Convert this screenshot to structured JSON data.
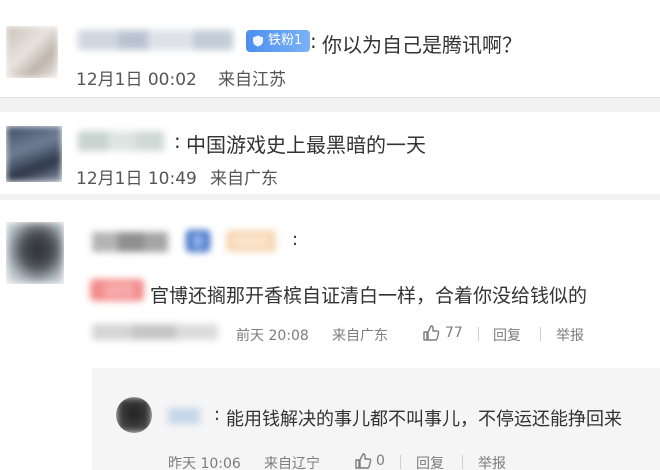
{
  "comments": [
    {
      "badge": "铁粉1",
      "text": "你以为自己是腾讯啊？",
      "colon": ":",
      "date": "12月1日 00:02",
      "location": "来自江苏"
    },
    {
      "colon": ":",
      "text": "中国游戏史上最黑暗的一天",
      "date": "12月1日 10:49",
      "location": "来自广东"
    },
    {
      "colon": ":",
      "text": "官博还搁那开香槟自证清白一样，合着你没给钱似的",
      "time": "前天 20:08",
      "location": "来自广东",
      "likes": "77",
      "reply_label": "回复",
      "report_label": "举报"
    }
  ],
  "reply": {
    "colon": ":",
    "text": "能用钱解决的事儿都不叫事儿，不停运还能挣回来",
    "time": "昨天 10:06",
    "location": "来自辽宁",
    "likes": "0",
    "reply_label": "回复",
    "report_label": "举报"
  },
  "colors": {
    "page_bg": "#f2f2f2",
    "card_bg": "#ffffff",
    "badge_blue": "#4d8ff0",
    "meta_gray": "#7d7d7d",
    "pink_tag": "#f48c8c"
  },
  "icons": [
    "shield-icon",
    "like-icon",
    "vip-badge-icon",
    "member-tag-icon"
  ]
}
